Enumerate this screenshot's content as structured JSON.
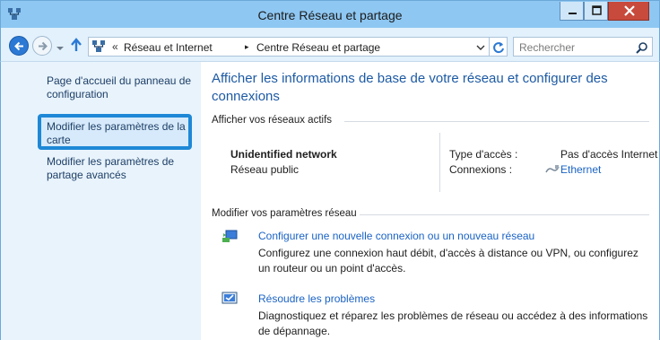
{
  "window": {
    "title": "Centre Réseau et partage",
    "icon": "network-icon",
    "controls": [
      "minimize",
      "maximize",
      "close"
    ]
  },
  "navbar": {
    "breadcrumbs": [
      "Réseau et Internet",
      "Centre Réseau et partage"
    ],
    "laquo": "«",
    "separator": "▸",
    "search_placeholder": "Rechercher"
  },
  "sidebar": {
    "items": [
      {
        "label": "Page d'accueil du panneau de configuration"
      },
      {
        "label": "Modifier les paramètres de la carte",
        "highlighted": true
      },
      {
        "label": "Modifier les paramètres de partage avancés"
      }
    ]
  },
  "main": {
    "title": "Afficher les informations de base de votre réseau et configurer des connexions",
    "active_networks_heading": "Afficher vos réseaux actifs",
    "network": {
      "name": "Unidentified network",
      "type": "Réseau public",
      "access_label": "Type d'accès :",
      "access_value": "Pas d'accès Internet",
      "connections_label": "Connexions :",
      "connections_value": "Ethernet"
    },
    "settings_heading": "Modifier vos paramètres réseau",
    "tasks": [
      {
        "icon": "new-connection-icon",
        "label": "Configurer une nouvelle connexion ou un nouveau réseau",
        "description": "Configurez une connexion haut débit, d'accès à distance ou VPN, ou configurez un routeur ou un point d'accès."
      },
      {
        "icon": "troubleshoot-icon",
        "label": "Résoudre les problèmes",
        "description": "Diagnostiquez et réparez les problèmes de réseau ou accédez à des informations de dépannage."
      }
    ]
  },
  "colors": {
    "titlebar": "#8ec7f2",
    "sidebar_bg": "#e8f3fc",
    "link": "#1a63c5",
    "heading": "#1d5aa4",
    "highlight": "#1e88d6",
    "close_button": "#c84a3c"
  }
}
